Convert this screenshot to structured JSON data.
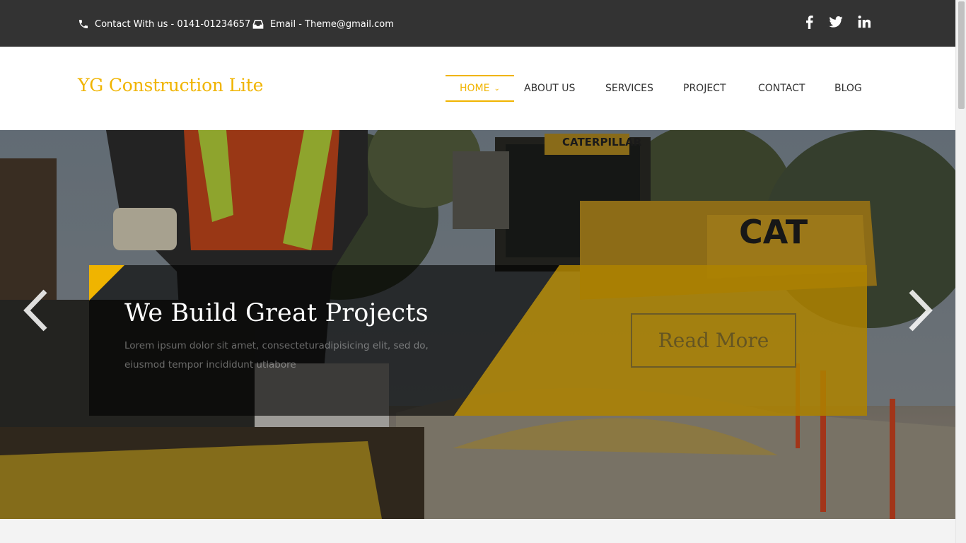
{
  "topbar": {
    "contact_text": "Contact With us - 0141-01234657",
    "email_text": "Email - Theme@gmail.com",
    "social": [
      "facebook-icon",
      "twitter-icon",
      "linkedin-icon"
    ]
  },
  "header": {
    "logo": "YG Construction Lite",
    "nav": [
      {
        "label": "HOME",
        "active": true
      },
      {
        "label": "ABOUT US"
      },
      {
        "label": "SERVICES"
      },
      {
        "label": "PROJECT"
      },
      {
        "label": "CONTACT"
      },
      {
        "label": "BLOG"
      }
    ],
    "home_chevron": "⌄"
  },
  "hero": {
    "title": "We Build Great Projects",
    "text": "Lorem ipsum dolor sit amet, consecteturadipisicing elit, sed do, eiusmod tempor incididunt utlabore",
    "button": "Read More",
    "prev_icon": "chevron-left-icon",
    "next_icon": "chevron-right-icon"
  },
  "colors": {
    "accent": "#f0b400",
    "topbar_bg": "#333333",
    "text": "#333333"
  }
}
